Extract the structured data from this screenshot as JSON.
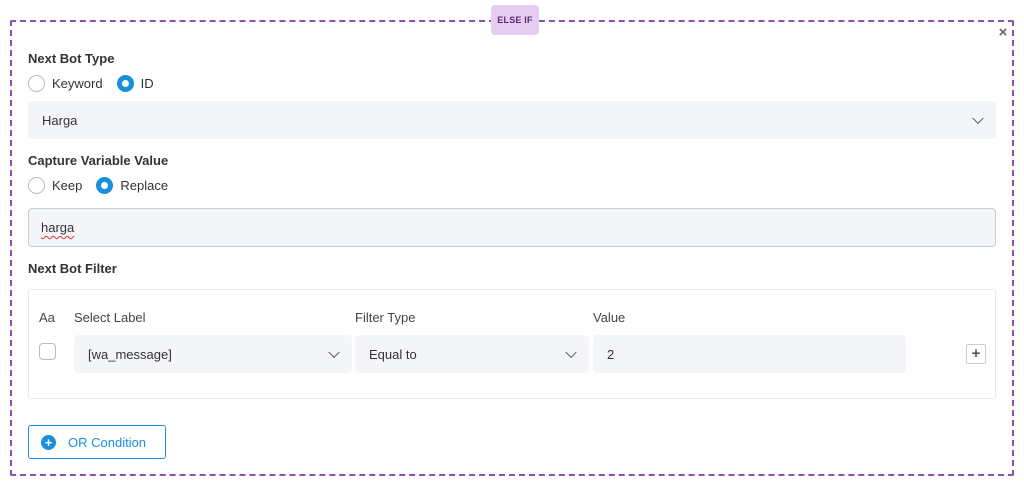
{
  "block": {
    "badge": "ELSE IF",
    "close_glyph": "×"
  },
  "next_bot_type": {
    "label": "Next Bot Type",
    "options": [
      {
        "label": "Keyword",
        "checked": false
      },
      {
        "label": "ID",
        "checked": true
      }
    ],
    "selected_value": "Harga"
  },
  "capture_variable": {
    "label": "Capture Variable Value",
    "options": [
      {
        "label": "Keep",
        "checked": false
      },
      {
        "label": "Replace",
        "checked": true
      }
    ],
    "input_value": "harga"
  },
  "next_bot_filter": {
    "label": "Next Bot Filter",
    "columns": [
      "Aa",
      "Select Label",
      "Filter Type",
      "Value"
    ],
    "row": {
      "case_sensitive": false,
      "label_value": "[wa_message]",
      "filter_type": "Equal to",
      "value": "2"
    },
    "add_glyph": "+"
  },
  "or_condition": {
    "label": "OR Condition",
    "icon": "plus-circle-icon"
  },
  "colors": {
    "accent": "#1a8fdc",
    "badge_bg": "#e6cdf2",
    "dashed_border": "#8e4fb5"
  }
}
